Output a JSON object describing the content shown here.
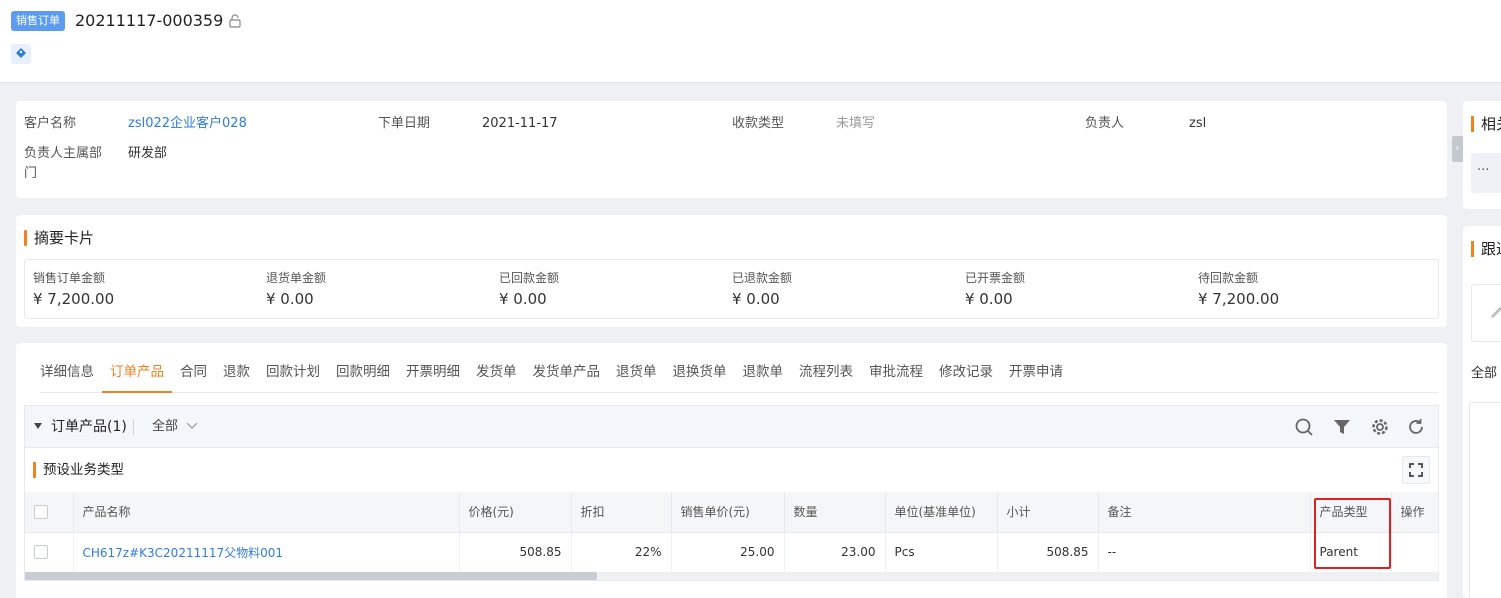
{
  "header": {
    "object_badge": "销售订单",
    "record_title": "20211117-000359"
  },
  "info": {
    "customer_label": "客户名称",
    "customer_value": "zsl022企业客户028",
    "order_date_label": "下单日期",
    "order_date_value": "2021-11-17",
    "payment_type_label": "收款类型",
    "payment_type_value": "未填写",
    "owner_label": "负责人",
    "owner_value": "zsl",
    "owner_dept_label": "负责人主属部门",
    "owner_dept_value": "研发部"
  },
  "summary": {
    "title": "摘要卡片",
    "items": [
      {
        "label": "销售订单金额",
        "value": "¥ 7,200.00"
      },
      {
        "label": "退货单金额",
        "value": "¥ 0.00"
      },
      {
        "label": "已回款金额",
        "value": "¥ 0.00"
      },
      {
        "label": "已退款金额",
        "value": "¥ 0.00"
      },
      {
        "label": "已开票金额",
        "value": "¥ 0.00"
      },
      {
        "label": "待回款金额",
        "value": "¥ 7,200.00"
      }
    ]
  },
  "tabs": [
    "详细信息",
    "订单产品",
    "合同",
    "退款",
    "回款计划",
    "回款明细",
    "开票明细",
    "发货单",
    "发货单产品",
    "退货单",
    "退换货单",
    "退款单",
    "流程列表",
    "审批流程",
    "修改记录",
    "开票申请"
  ],
  "active_tab": "订单产品",
  "products": {
    "title": "订单产品(1)",
    "filter": "全部",
    "business_type": "预设业务类型",
    "columns": [
      "产品名称",
      "价格(元)",
      "折扣",
      "销售单价(元)",
      "数量",
      "单位(基准单位)",
      "小计",
      "备注",
      "产品类型",
      "操作"
    ],
    "rows": [
      {
        "name": "CH617z#K3C20211117父物料001",
        "price": "508.85",
        "discount": "22%",
        "unit_price": "25.00",
        "qty": "23.00",
        "unit": "Pcs",
        "subtotal": "508.85",
        "remark": "--",
        "product_type": "Parent",
        "action": ""
      }
    ]
  },
  "right_panel": {
    "card1_title": "相关",
    "card1_more": "···",
    "card2_title": "跟进",
    "card2_filter": "全部"
  },
  "colors": {
    "accent": "#f0821f",
    "link": "#2f7ce0",
    "badge": "#5b9cf1",
    "highlight": "#e02020"
  }
}
